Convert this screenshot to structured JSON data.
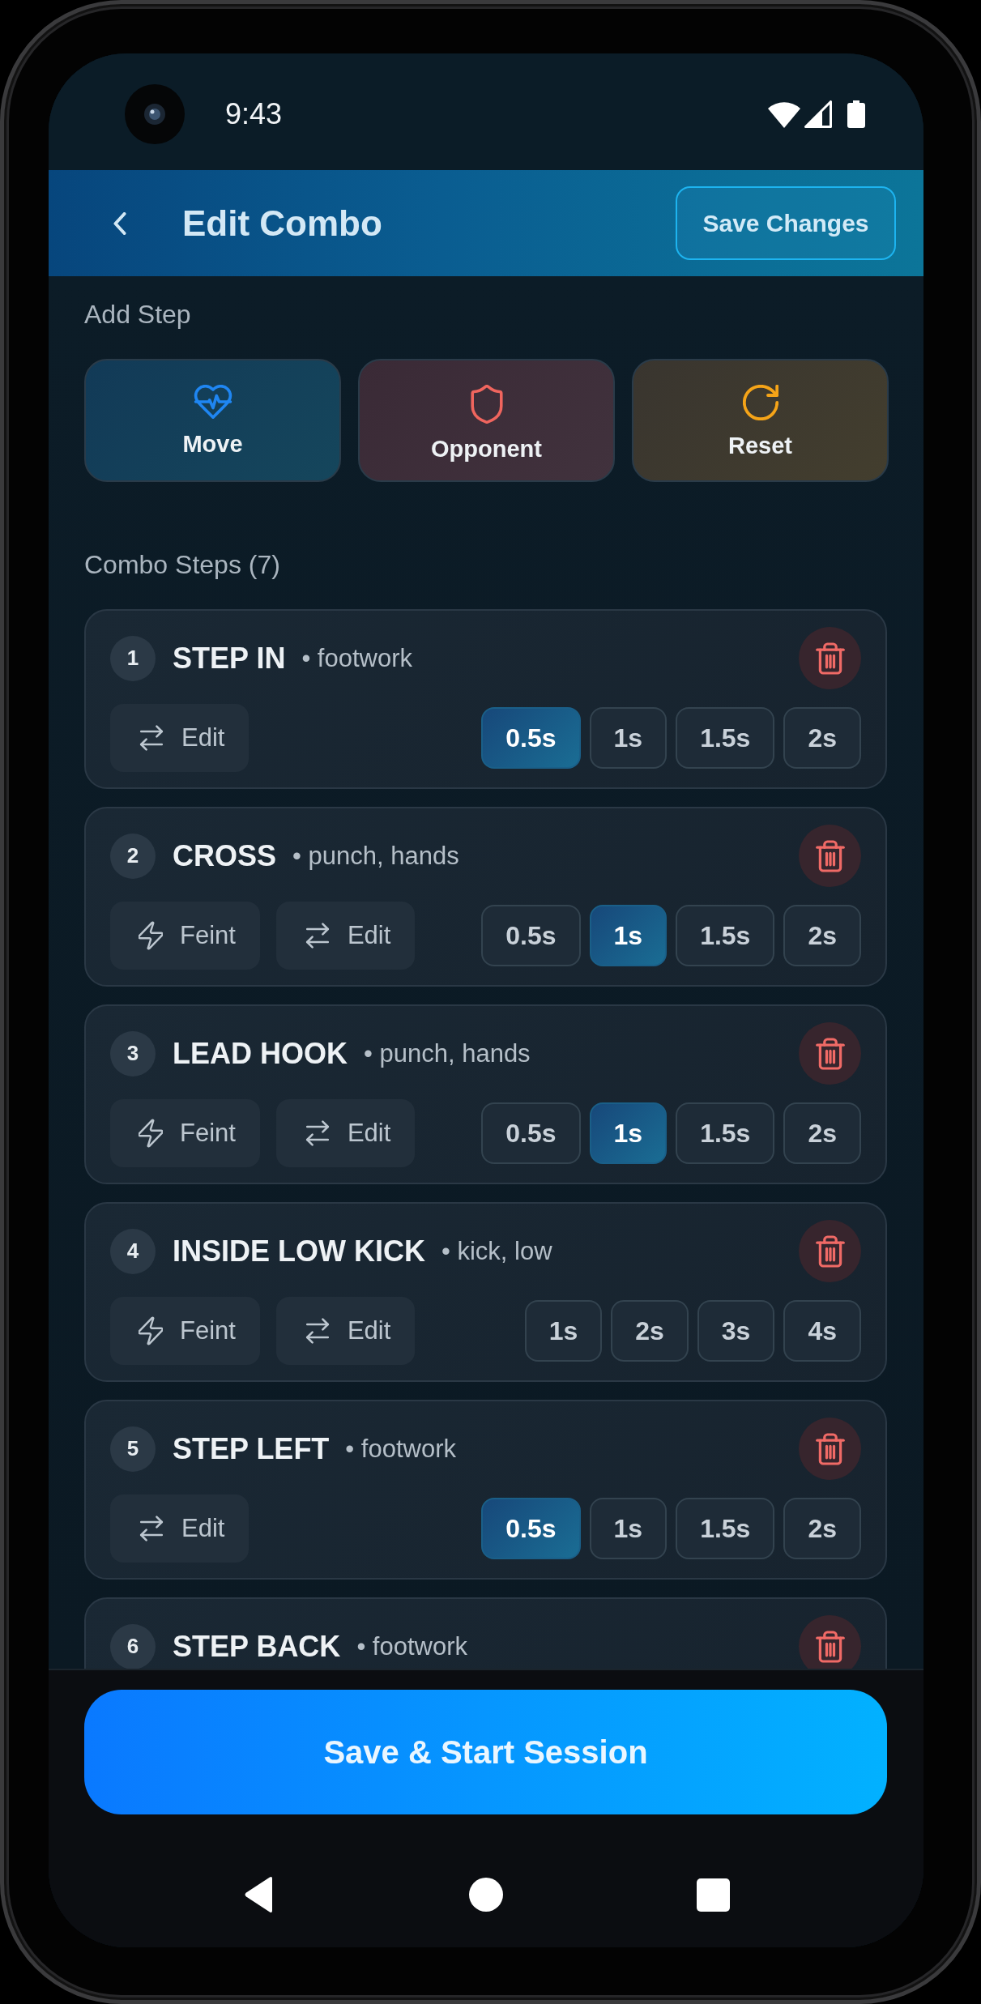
{
  "status_bar": {
    "time": "9:43"
  },
  "header": {
    "title": "Edit Combo",
    "save_button": "Save Changes"
  },
  "add_step": {
    "label": "Add Step",
    "options": [
      {
        "kind": "move",
        "label": "Move"
      },
      {
        "kind": "opponent",
        "label": "Opponent"
      },
      {
        "kind": "reset",
        "label": "Reset"
      }
    ]
  },
  "steps_section": {
    "label": "Combo Steps (7)"
  },
  "steps": [
    {
      "number": "1",
      "name": "STEP IN",
      "tags": "• footwork",
      "actions": [
        {
          "kind": "edit",
          "label": "Edit"
        }
      ],
      "durations": [
        {
          "label": "0.5s",
          "selected": true
        },
        {
          "label": "1s",
          "selected": false
        },
        {
          "label": "1.5s",
          "selected": false
        },
        {
          "label": "2s",
          "selected": false
        }
      ]
    },
    {
      "number": "2",
      "name": "CROSS",
      "tags": "• punch, hands",
      "actions": [
        {
          "kind": "feint",
          "label": "Feint"
        },
        {
          "kind": "edit",
          "label": "Edit"
        }
      ],
      "durations": [
        {
          "label": "0.5s",
          "selected": false
        },
        {
          "label": "1s",
          "selected": true
        },
        {
          "label": "1.5s",
          "selected": false
        },
        {
          "label": "2s",
          "selected": false
        }
      ]
    },
    {
      "number": "3",
      "name": "LEAD HOOK",
      "tags": "• punch, hands",
      "actions": [
        {
          "kind": "feint",
          "label": "Feint"
        },
        {
          "kind": "edit",
          "label": "Edit"
        }
      ],
      "durations": [
        {
          "label": "0.5s",
          "selected": false
        },
        {
          "label": "1s",
          "selected": true
        },
        {
          "label": "1.5s",
          "selected": false
        },
        {
          "label": "2s",
          "selected": false
        }
      ]
    },
    {
      "number": "4",
      "name": "INSIDE LOW KICK",
      "tags": "• kick, low",
      "actions": [
        {
          "kind": "feint",
          "label": "Feint"
        },
        {
          "kind": "edit",
          "label": "Edit"
        }
      ],
      "durations": [
        {
          "label": "1s",
          "selected": false
        },
        {
          "label": "2s",
          "selected": false
        },
        {
          "label": "3s",
          "selected": false
        },
        {
          "label": "4s",
          "selected": false
        }
      ]
    },
    {
      "number": "5",
      "name": "STEP LEFT",
      "tags": "• footwork",
      "actions": [
        {
          "kind": "edit",
          "label": "Edit"
        }
      ],
      "durations": [
        {
          "label": "0.5s",
          "selected": true
        },
        {
          "label": "1s",
          "selected": false
        },
        {
          "label": "1.5s",
          "selected": false
        },
        {
          "label": "2s",
          "selected": false
        }
      ]
    },
    {
      "number": "6",
      "name": "STEP BACK",
      "tags": "• footwork"
    }
  ],
  "primary_button": {
    "label": "Save & Start Session"
  }
}
